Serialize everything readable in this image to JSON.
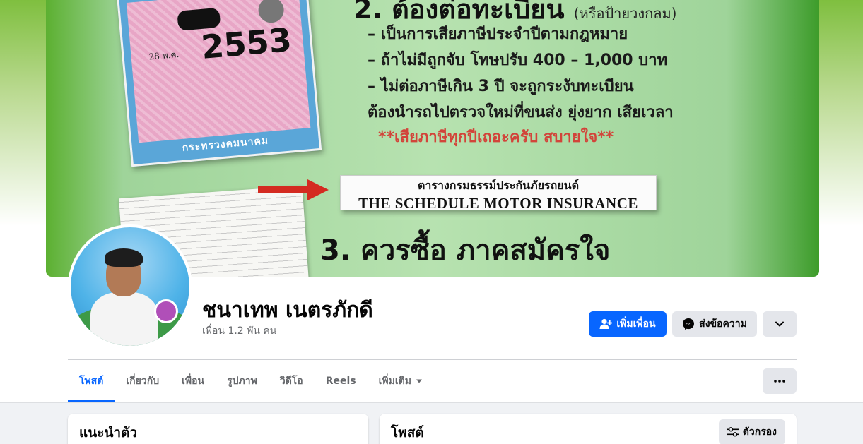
{
  "cover": {
    "heading": "2. ต้องต่อทะเบียน",
    "heading_sub": "(หรือป้ายวงกลม)",
    "list": [
      "– เป็นการเสียภาษีประจำปีตามกฎหมาย",
      "– ถ้าไม่มีถูกจับ โทษปรับ 400 – 1,000 บาท",
      "– ไม่ต่อภาษีเกิน 3 ปี จะถูกระงับทะเบียน",
      "ต้องนำรถไปตรวจใหม่ที่ขนส่ง ยุ่งยาก เสียเวลา"
    ],
    "note": "**เสียภาษีทุกปีเถอะครับ สบายใจ**",
    "tax_card": {
      "year": "2553",
      "small_text": "28 พ.ค.",
      "footer": "กระทรวงคมนาคม"
    },
    "insurance_thai": "ตารางกรมธรรม์ประกันภัยรถยนต์",
    "insurance_en": "THE SCHEDULE MOTOR INSURANCE",
    "big_text": "3. ควรซื้อ ภาคสมัครใจ"
  },
  "profile": {
    "name": "ชนาเทพ เนตรภักดี",
    "friends": "เพื่อน 1.2 พัน คน"
  },
  "actions": {
    "add_friend": "เพิ่มเพื่อน",
    "message": "ส่งข้อความ"
  },
  "tabs": [
    {
      "label": "โพสต์"
    },
    {
      "label": "เกี่ยวกับ"
    },
    {
      "label": "เพื่อน"
    },
    {
      "label": "รูปภาพ"
    },
    {
      "label": "วิดีโอ"
    },
    {
      "label": "Reels"
    },
    {
      "label": "เพิ่มเติม"
    }
  ],
  "intro": {
    "title": "แนะนำตัว"
  },
  "posts": {
    "title": "โพสต์",
    "filter": "ตัวกรอง"
  },
  "colors": {
    "accent": "#0866ff",
    "secondary_bg": "#e4e6eb",
    "feed_bg": "#f0f2f5"
  },
  "icons": [
    "add-friend-icon",
    "messenger-icon",
    "chevron-down-icon",
    "more-dots-icon",
    "filter-icon",
    "dropdown-caret-icon"
  ]
}
